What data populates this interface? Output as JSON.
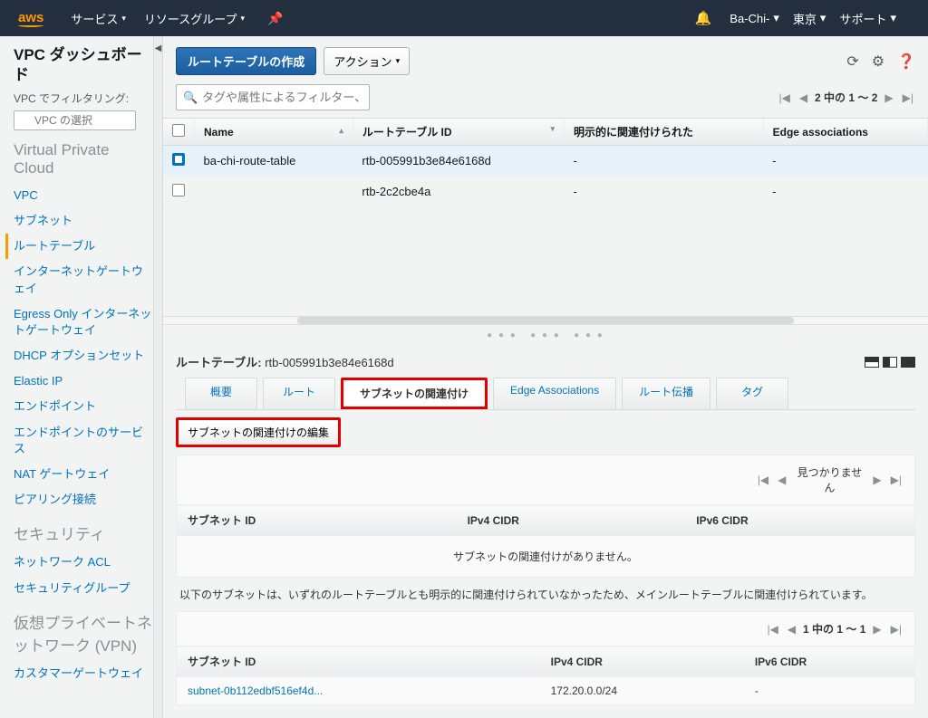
{
  "header": {
    "logo": "aws",
    "services": "サービス",
    "resource_groups": "リソースグループ",
    "account": "Ba-Chi-",
    "region": "東京",
    "support": "サポート"
  },
  "sidebar": {
    "title": "VPC ダッシュボード",
    "filter_label": "VPC でフィルタリング:",
    "filter_placeholder": "VPC の選択",
    "section_vpc": "Virtual Private Cloud",
    "links": {
      "vpc": "VPC",
      "subnet": "サブネット",
      "route_tables": "ルートテーブル",
      "igw": "インターネットゲートウェイ",
      "egress_igw": "Egress Only インターネットゲートウェイ",
      "dhcp": "DHCP オプションセット",
      "eip": "Elastic IP",
      "endpoint": "エンドポイント",
      "endpoint_service": "エンドポイントのサービス",
      "nat": "NAT ゲートウェイ",
      "peering": "ピアリング接続"
    },
    "section_security": "セキュリティ",
    "links_sec": {
      "nacl": "ネットワーク ACL",
      "sg": "セキュリティグループ"
    },
    "section_vpn": "仮想プライベートネットワーク (VPN)",
    "links_vpn": {
      "cgw": "カスタマーゲートウェイ"
    }
  },
  "actions": {
    "create": "ルートテーブルの作成",
    "action": "アクション"
  },
  "search": {
    "placeholder": "タグや属性によるフィルター、またはキーワードによる検索"
  },
  "pagination": {
    "top": "2 中の 1 ～ 2",
    "sub1_notfound": "見つかりません",
    "sub2": "1 中の 1 ～ 1"
  },
  "table": {
    "cols": {
      "name": "Name",
      "id": "ルートテーブル ID",
      "explicit": "明示的に関連付けられた",
      "edge": "Edge associations"
    },
    "rows": [
      {
        "name": "ba-chi-route-table",
        "id": "rtb-005991b3e84e6168d",
        "explicit": "-",
        "edge": "-",
        "selected": true
      },
      {
        "name": "",
        "id": "rtb-2c2cbe4a",
        "explicit": "-",
        "edge": "-",
        "selected": false
      }
    ]
  },
  "details": {
    "label": "ルートテーブル:",
    "id": "rtb-005991b3e84e6168d",
    "tabs": {
      "summary": "概要",
      "routes": "ルート",
      "subnet_assoc": "サブネットの関連付け",
      "edge_assoc": "Edge Associations",
      "route_prop": "ルート伝播",
      "tags": "タグ"
    },
    "edit_btn": "サブネットの関連付けの編集",
    "sub_cols": {
      "subnet_id": "サブネット ID",
      "ipv4": "IPv4 CIDR",
      "ipv6": "IPv6 CIDR"
    },
    "empty_msg": "サブネットの関連付けがありません。",
    "note": "以下のサブネットは、いずれのルートテーブルとも明示的に関連付けられていなかったため、メインルートテーブルに関連付けられています。",
    "subnet_rows": [
      {
        "id": "subnet-0b112edbf516ef4d...",
        "ipv4": "172.20.0.0/24",
        "ipv6": "-"
      }
    ]
  }
}
